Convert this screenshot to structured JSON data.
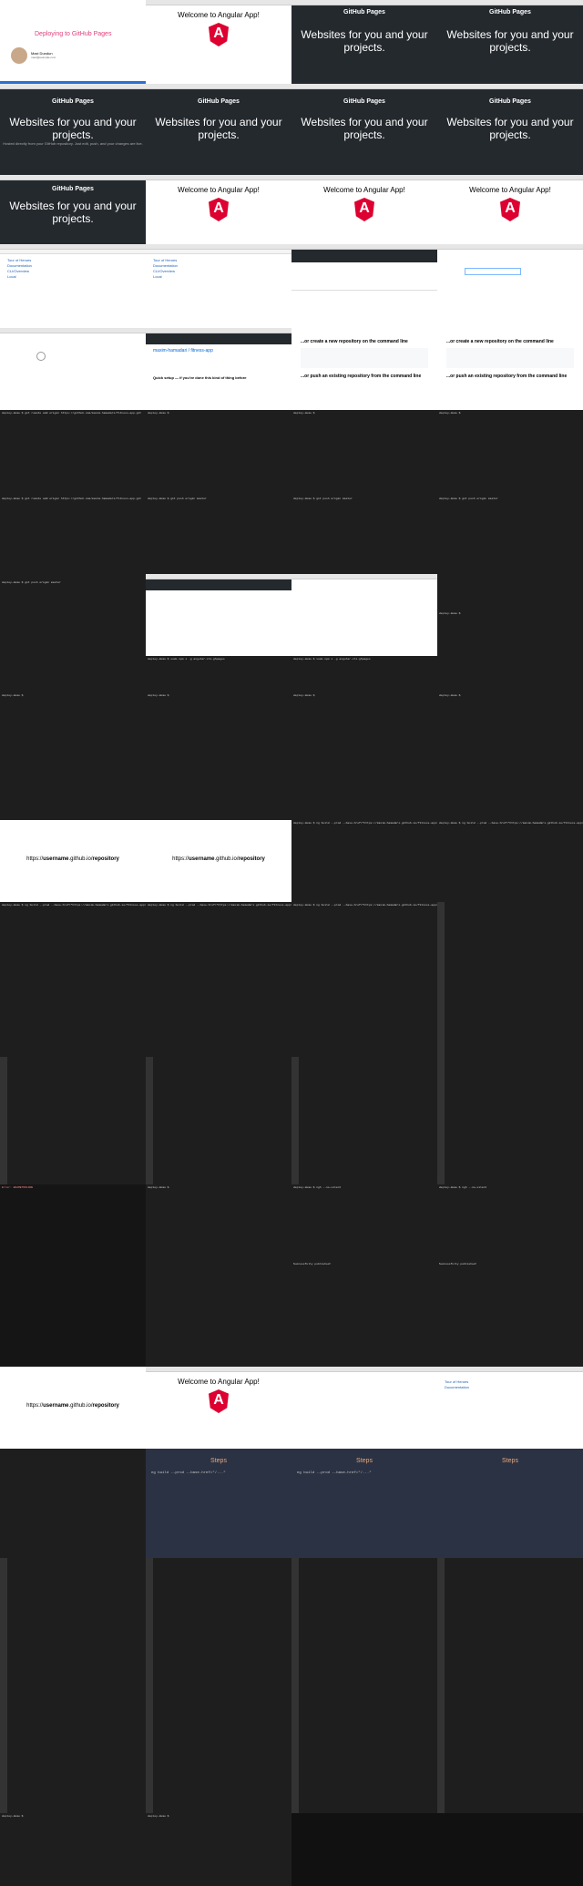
{
  "slide": {
    "title": "Deploying to GitHub Pages",
    "author": "Maxi Dundun",
    "email": "maxi@example.com"
  },
  "browser": {
    "url_local": "localhost:4200",
    "url_pages": "https://pages.github.com",
    "url_repo": "https://github.com/maxim-hamadari/fitness-app"
  },
  "angular": {
    "title": "Welcome to Angular App!"
  },
  "ghpages": {
    "logo": "GitHub Pages",
    "hero": "Websites for you and your projects.",
    "sub": "Hosted directly from your GitHub repository. Just edit, push, and your changes are live."
  },
  "links": [
    "Tour of Heroes",
    "Documentation",
    "CLI/Overview",
    "Local"
  ],
  "repo": {
    "title": "Quick setup — if you've done this kind of thing before",
    "create": "...or create a new repository on the command line",
    "push": "...or push an existing repository from the command line"
  },
  "term": {
    "prompt": "deploy-demo $",
    "cmd_remote": "deploy-demo $ git remote add origin https://github.com/maxim-hamadari/fitness-app.git",
    "cmd_push": "deploy-demo $ git push origin master",
    "cmd_sudo": "deploy-demo $ sudo npm i -g angular-cli-ghpages",
    "cmd_build": "deploy-demo $ ng build --prod --base-href=\"https://maxim-hamadari.github.io/fitness-app/\"",
    "cmd_ngh": "deploy-demo $ ngh --no-silent",
    "published": "Successfully published!"
  },
  "repo_url": {
    "pre": "https://",
    "mid": "username",
    "post": ".github.io/",
    "end": "repository"
  },
  "steps": {
    "title": "Steps",
    "line": "ng build --prod --base-href=\"/...\""
  }
}
